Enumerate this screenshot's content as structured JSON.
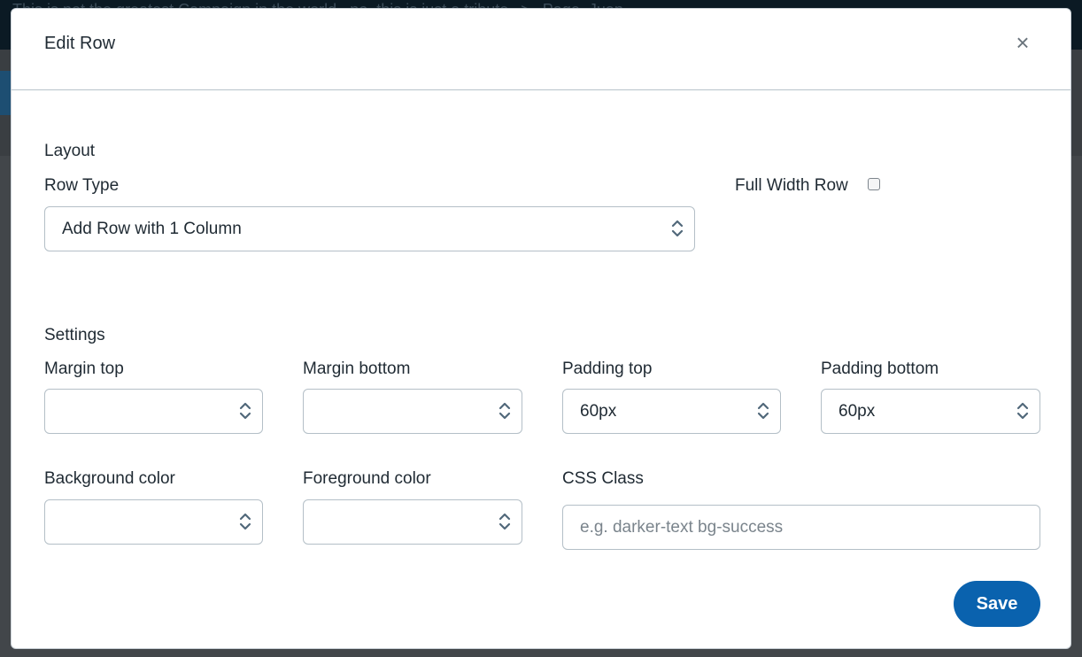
{
  "background": {
    "breadcrumb_left": "This is not the greatest Campaign in the world...no, this is just a tribute",
    "breadcrumb_sep": ">",
    "breadcrumb_right": "Page, Juan"
  },
  "modal": {
    "title": "Edit Row",
    "close_label": "×",
    "layout": {
      "section_label": "Layout",
      "row_type_label": "Row Type",
      "row_type_value": "Add Row with 1 Column",
      "full_width_label": "Full Width Row",
      "full_width_checked": false
    },
    "settings": {
      "section_label": "Settings",
      "margin_top_label": "Margin top",
      "margin_top_value": "",
      "margin_bottom_label": "Margin bottom",
      "margin_bottom_value": "",
      "padding_top_label": "Padding top",
      "padding_top_value": "60px",
      "padding_bottom_label": "Padding bottom",
      "padding_bottom_value": "60px",
      "background_color_label": "Background color",
      "background_color_value": "",
      "foreground_color_label": "Foreground color",
      "foreground_color_value": "",
      "css_class_label": "CSS Class",
      "css_class_placeholder": "e.g. darker-text bg-success",
      "css_class_value": ""
    },
    "save_label": "Save"
  },
  "colors": {
    "primary": "#0a62ae",
    "overlay": "#3f4246"
  }
}
